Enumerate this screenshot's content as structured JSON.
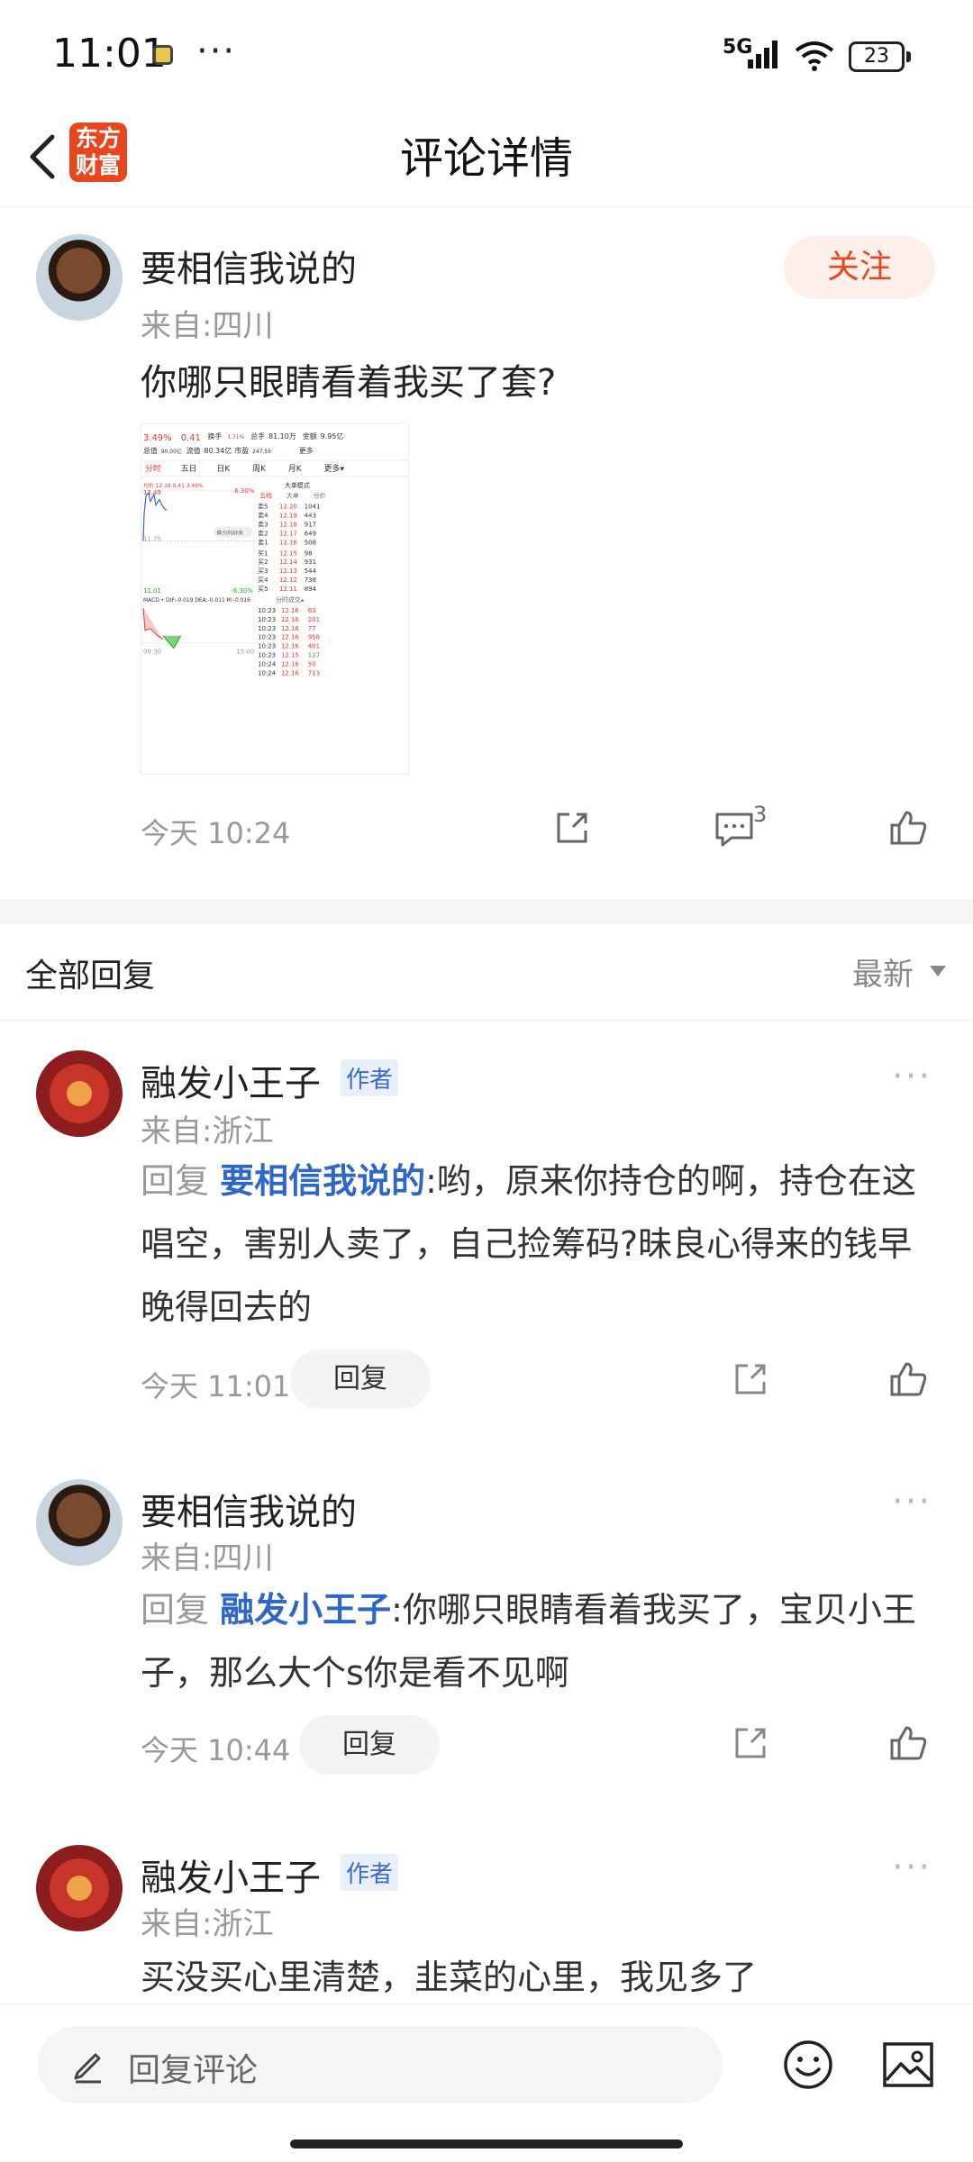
{
  "status": {
    "time": "11:01",
    "dots": "···",
    "network": "5G",
    "battery": "23"
  },
  "nav": {
    "title": "评论详情",
    "logo_line1": "东方",
    "logo_line2": "财富"
  },
  "post": {
    "user": "要相信我说的",
    "location": "来自:四川",
    "follow": "关注",
    "text": "你哪只眼睛看着我买了套?",
    "time": "今天 10:24",
    "comment_count": "3",
    "stock": {
      "pct": "3.49%",
      "chg": "0.41",
      "turnover_label": "换手",
      "turnover": "1.71%",
      "vol_label": "总手",
      "vol": "81.10万",
      "amt_label": "金额",
      "amt": "9.95亿",
      "total_label": "总值",
      "total": "90.00亿",
      "float_label": "流值",
      "float": "80.34亿",
      "pe_label": "市盈",
      "pe": "247.59",
      "more": "更多",
      "tabs": [
        "分时",
        "五日",
        "日K",
        "周K",
        "月K",
        "更多▾"
      ],
      "price_line": "均价 12.16 0.41 3.49%",
      "big_order": "大单模式",
      "hi": "12.49",
      "mid": "11.75",
      "lo": "11.01",
      "up_pct": "6.30%",
      "dn_pct": "-6.30%",
      "macd": "MACD • DIF:-0.019 DEA:-0.011 M:-0.016",
      "t_start": "09:30",
      "t_end": "15:00",
      "ob_head": [
        "五档",
        "大单",
        "分价"
      ],
      "asks": [
        [
          "卖5",
          "12.20",
          "1041"
        ],
        [
          "卖4",
          "12.19",
          "443"
        ],
        [
          "卖3",
          "12.18",
          "917"
        ],
        [
          "卖2",
          "12.17",
          "649"
        ],
        [
          "卖1",
          "12.16",
          "508"
        ]
      ],
      "bids": [
        [
          "买1",
          "12.15",
          "98"
        ],
        [
          "买2",
          "12.14",
          "931"
        ],
        [
          "买3",
          "12.13",
          "544"
        ],
        [
          "买4",
          "12.12",
          "738"
        ],
        [
          "买5",
          "12.11",
          "894"
        ]
      ],
      "trade_head": "分时成交▴",
      "trades": [
        [
          "10:23",
          "12.16",
          "63"
        ],
        [
          "10:23",
          "12.16",
          "201"
        ],
        [
          "10:23",
          "12.16",
          "77"
        ],
        [
          "10:23",
          "12.16",
          "958"
        ],
        [
          "10:23",
          "12.16",
          "401"
        ],
        [
          "10:23",
          "12.15",
          "127"
        ],
        [
          "10:24",
          "12.16",
          "50"
        ],
        [
          "10:24",
          "12.16",
          "713"
        ]
      ],
      "bubble": "算力利好来"
    }
  },
  "replies_header": {
    "title": "全部回复",
    "sort": "最新"
  },
  "replies": [
    {
      "user": "融发小王子",
      "tag": "作者",
      "location": "来自:浙江",
      "reply_label": "回复",
      "reply_to": "要相信我说的",
      "text": ":哟，原来你持仓的啊，持仓在这唱空，害别人卖了，自己捡筹码?昧良心得来的钱早晚得回去的",
      "time": "今天 11:01",
      "reply_btn": "回复"
    },
    {
      "user": "要相信我说的",
      "location": "来自:四川",
      "reply_label": "回复",
      "reply_to": "融发小王子",
      "text": ":你哪只眼睛看着我买了，宝贝小王子，那么大个s你是看不见啊",
      "time": "今天 10:44",
      "reply_btn": "回复"
    },
    {
      "user": "融发小王子",
      "tag": "作者",
      "location": "来自:浙江",
      "text": "买没买心里清楚，韭菜的心里，我见多了"
    }
  ],
  "bottom": {
    "placeholder": "回复评论"
  },
  "icons": {
    "back": "back-arrow-icon",
    "share": "share-icon",
    "comment": "comment-icon",
    "like": "thumbs-up-icon",
    "emoji": "emoji-icon",
    "image": "image-icon",
    "pencil": "pencil-icon"
  }
}
